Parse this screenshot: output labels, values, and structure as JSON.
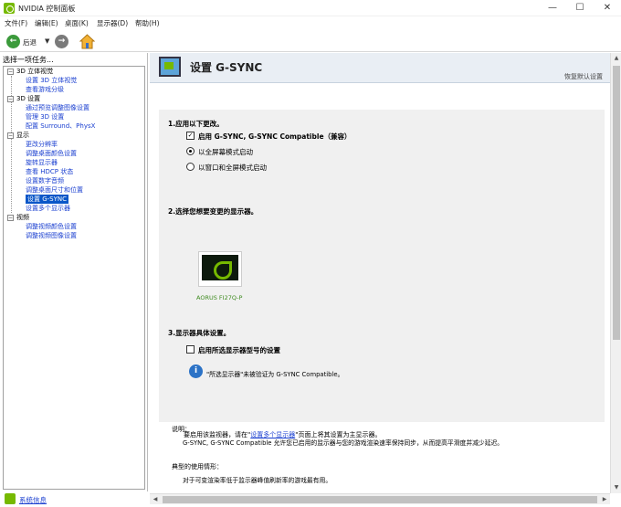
{
  "window": {
    "title": "NVIDIA 控制面板",
    "minimize": "—",
    "maximize": "☐",
    "close": "✕"
  },
  "menu": [
    "文件(F)",
    "编辑(E)",
    "桌面(K)",
    "显示器(D)",
    "帮助(H)"
  ],
  "toolbar": {
    "back_label": "后退",
    "back_icon": "back-arrow-icon",
    "forward_icon": "forward-arrow-icon",
    "home_icon": "home-icon"
  },
  "sidebar": {
    "header": "选择一项任务...",
    "tree": [
      {
        "label": "3D 设置",
        "type": "category"
      },
      {
        "label": "通过预览调整图像设置",
        "type": "link"
      },
      {
        "label": "管理 3D 设置",
        "type": "link"
      },
      {
        "label": "配置 Surround、PhysX",
        "type": "link"
      },
      {
        "label": "显示",
        "type": "category"
      },
      {
        "label": "更改分辨率",
        "type": "link"
      },
      {
        "label": "调整桌面颜色设置",
        "type": "link"
      },
      {
        "label": "旋转显示器",
        "type": "link"
      },
      {
        "label": "查看 HDCP 状态",
        "type": "link"
      },
      {
        "label": "设置数字音频",
        "type": "link"
      },
      {
        "label": "调整桌面尺寸和位置",
        "type": "link"
      },
      {
        "label": "设置 G-SYNC",
        "type": "selected"
      },
      {
        "label": "设置多个显示器",
        "type": "link"
      },
      {
        "label": "视频",
        "type": "category"
      },
      {
        "label": "调整视频颜色设置",
        "type": "link"
      },
      {
        "label": "调整视频图像设置",
        "type": "link"
      }
    ],
    "tree_top": [
      {
        "label": "3D 立体视觉",
        "type": "category"
      },
      {
        "label": "设置 3D 立体视觉",
        "type": "link"
      },
      {
        "label": "查看游戏分级",
        "type": "link"
      }
    ]
  },
  "status": {
    "link": "系统信息"
  },
  "main": {
    "title": "设置 G-SYNC",
    "restore_link": "恢复默认设置",
    "section1": {
      "title": "1.应用以下更改。",
      "checkbox_label": "启用 G-SYNC, G-SYNC Compatible（兼容）",
      "checkbox_checked": true,
      "checkbox_mark": "✓",
      "radio_fullscreen": "以全屏幕模式启动",
      "radio_windowed": "以窗口和全屏模式启动",
      "selected_radio": "fullscreen"
    },
    "section2": {
      "title": "2.选择您想要变更的显示器。",
      "monitor_label": "AORUS FI27Q-P"
    },
    "section3": {
      "title": "3.显示器具体设置。",
      "checkbox_label": "启用所选显示器型号的设置",
      "checkbox_checked": false,
      "info_text": "\"所选显示器\"未被验证为 G-SYNC Compatible。",
      "info_glyph": "i"
    },
    "note_prefix": "要启用该监视器，请在\"",
    "note_link": "设置多个显示器",
    "note_suffix": "\"页面上将其设置为主显示器。",
    "description": {
      "head": "说明：",
      "text": "G-SYNC, G-SYNC Compatible 允许您已启用的监示器与您的游戏渲染速率保持同步，从而提高平滑度并减少延迟。",
      "usage_head": "典型的使用情形：",
      "usage_text": "对于可变渲染率低于监示器峰值刷新率的游戏最有用。"
    }
  },
  "colors": {
    "nvidia_green": "#76b900",
    "link_blue": "#1a3fd0",
    "selection_blue": "#0a56c8"
  }
}
